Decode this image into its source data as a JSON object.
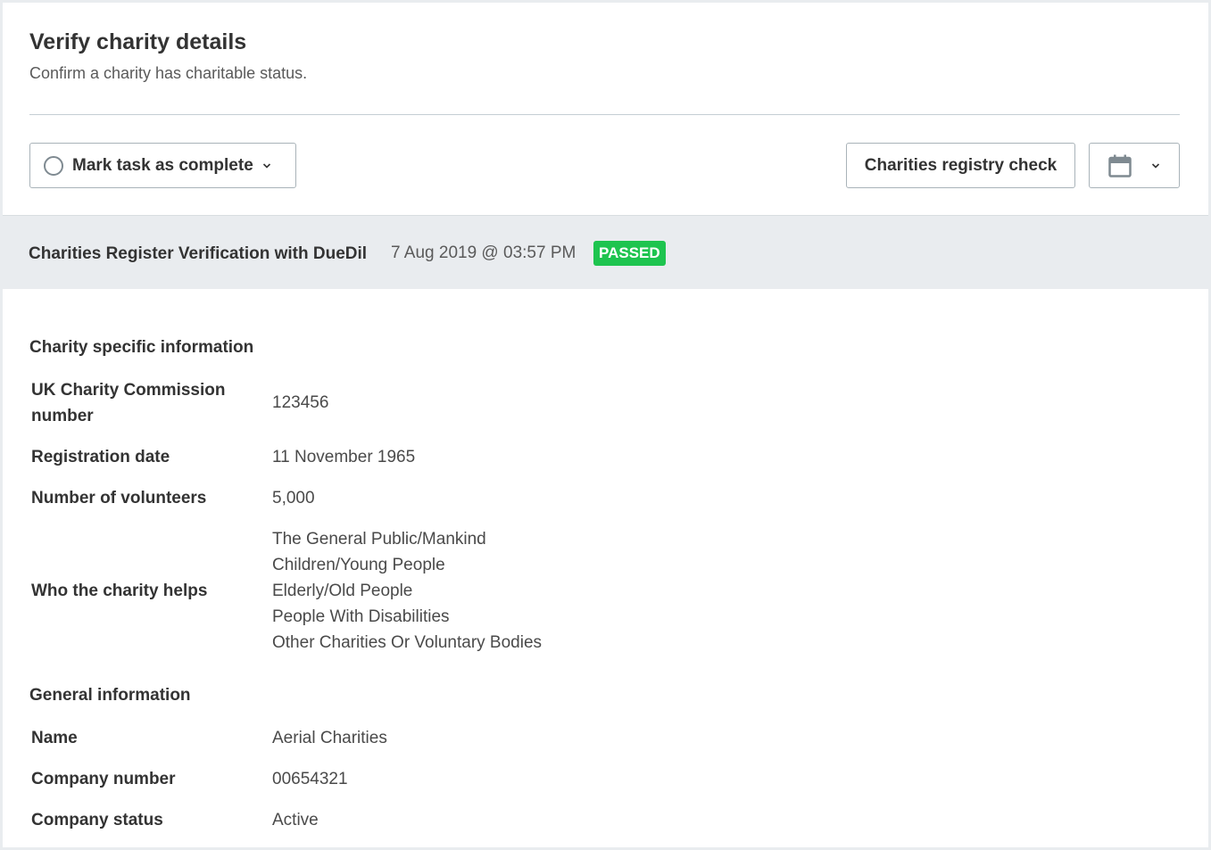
{
  "header": {
    "title": "Verify charity details",
    "subtitle": "Confirm a charity has charitable status."
  },
  "toolbar": {
    "complete_label": "Mark task as complete",
    "registry_label": "Charities registry check",
    "calendar_icon": "calendar-icon",
    "chevron_icon": "chevron-down-icon"
  },
  "check": {
    "title": "Charities Register Verification with DueDil",
    "timestamp": "7 Aug 2019 @ 03:57 PM",
    "status": "PASSED",
    "status_color": "#1ec44f"
  },
  "charity_section": {
    "title": "Charity specific information",
    "commission_label_1": "UK Charity Commission",
    "commission_label_2": "number",
    "commission_value": "123456",
    "registration_label": "Registration date",
    "registration_value": "11 November 1965",
    "volunteers_label": "Number of volunteers",
    "volunteers_value": "5,000",
    "helps_label": "Who the charity helps",
    "helps_values": [
      "The General Public/Mankind",
      "Children/Young People",
      "Elderly/Old People",
      "People With Disabilities",
      "Other Charities Or Voluntary Bodies"
    ]
  },
  "general_section": {
    "title": "General information",
    "name_label": "Name",
    "name_value": "Aerial Charities",
    "company_number_label": "Company number",
    "company_number_value": "00654321",
    "company_status_label": "Company status",
    "company_status_value": "Active"
  }
}
